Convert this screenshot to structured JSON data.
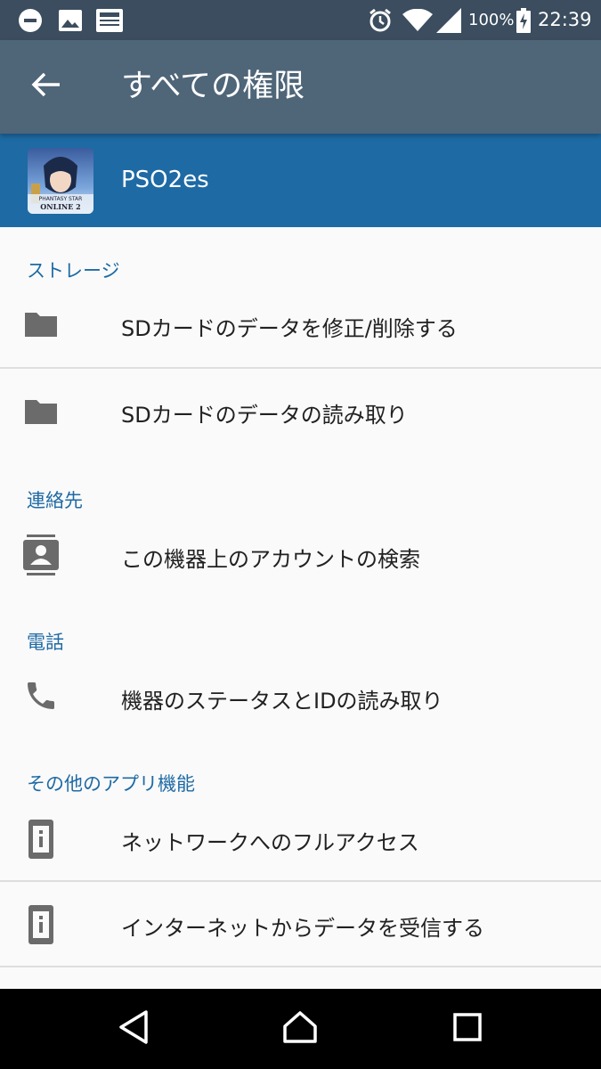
{
  "status_bar": {
    "battery": "100%",
    "time": "22:39",
    "icons": [
      "minus-circle-icon",
      "image-icon",
      "news-icon",
      "alarm-icon",
      "wifi-icon",
      "signal-icon",
      "battery-charging-icon"
    ]
  },
  "app_bar": {
    "back_icon": "arrow-back-icon",
    "title": "すべての権限"
  },
  "app_header": {
    "app_name": "PSO2es",
    "icon_caption_1": "PHANTASY STAR",
    "icon_caption_2": "ONLINE 2"
  },
  "permissions": {
    "storage": {
      "header": "ストレージ",
      "items": [
        {
          "label": "SDカードのデータを修正/削除する",
          "icon": "folder-icon"
        },
        {
          "label": "SDカードのデータの読み取り",
          "icon": "folder-icon"
        }
      ]
    },
    "contacts": {
      "header": "連絡先",
      "items": [
        {
          "label": "この機器上のアカウントの検索",
          "icon": "contacts-icon"
        }
      ]
    },
    "phone": {
      "header": "電話",
      "items": [
        {
          "label": "機器のステータスとIDの読み取り",
          "icon": "phone-icon"
        }
      ]
    },
    "other": {
      "header": "その他のアプリ機能",
      "items": [
        {
          "label": "ネットワークへのフルアクセス",
          "icon": "device-info-icon"
        },
        {
          "label": "インターネットからデータを受信する",
          "icon": "device-info-icon"
        }
      ]
    }
  },
  "nav_bar": {
    "buttons": [
      "back-triangle-icon",
      "home-circle-icon",
      "recents-square-icon"
    ]
  },
  "colors": {
    "status_bar": "#3b4d5e",
    "app_bar": "#4f6578",
    "app_header": "#1e6aa4",
    "section_header_text": "#1e6aa4",
    "background": "#fafafa"
  }
}
